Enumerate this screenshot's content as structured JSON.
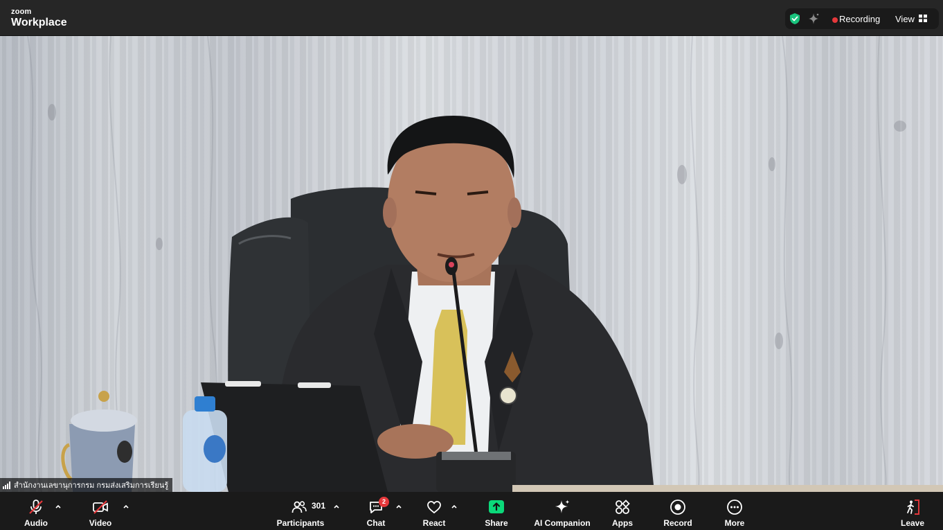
{
  "app": {
    "brand_top": "zoom",
    "brand_name": "Workplace"
  },
  "header": {
    "recording_label": "Recording",
    "view_label": "View",
    "security_icon": "shield-check-icon",
    "ai_icon": "sparkle-icon"
  },
  "video": {
    "participant_name": "สำนักงานเลขานุการกรม กรมส่งเสริมการเรียนรู้"
  },
  "toolbar": {
    "audio_label": "Audio",
    "video_label": "Video",
    "participants_label": "Participants",
    "participants_count": "301",
    "chat_label": "Chat",
    "chat_badge": "2",
    "react_label": "React",
    "share_label": "Share",
    "ai_companion_label": "AI Companion",
    "apps_label": "Apps",
    "record_label": "Record",
    "more_label": "More",
    "leave_label": "Leave"
  },
  "colors": {
    "toolbar_bg": "#1a1a1a",
    "topbar_bg": "#262626",
    "share_green": "#0bd97a",
    "alert_red": "#e5383b",
    "secure_green": "#19c37d"
  }
}
